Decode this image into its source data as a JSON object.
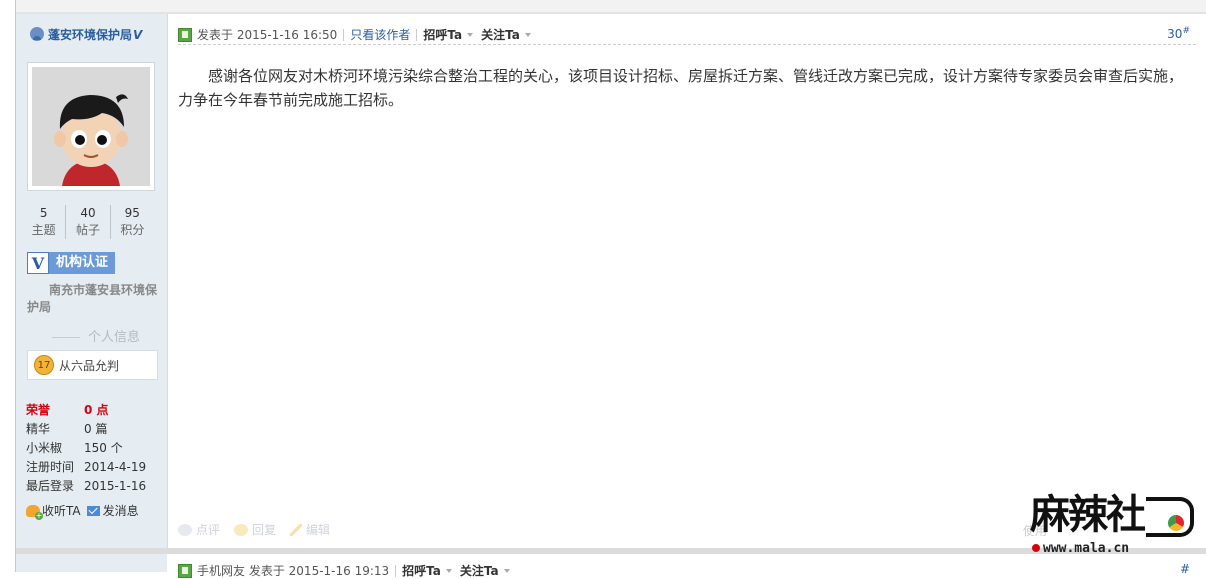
{
  "user": {
    "name": "蓬安环境保护局",
    "verified_mark": "V",
    "stats": [
      {
        "value": "5",
        "label": "主题"
      },
      {
        "value": "40",
        "label": "帖子"
      },
      {
        "value": "95",
        "label": "积分"
      }
    ],
    "verify_badge": {
      "icon": "V",
      "label": "机构认证"
    },
    "organization": "南充市蓬安县环境保护局",
    "personal_info_title": "个人信息",
    "rank": {
      "level": "17",
      "title": "从六品允判"
    },
    "attributes": [
      {
        "key": "荣誉",
        "value": "0 点",
        "highlight": true
      },
      {
        "key": "精华",
        "value": "0 篇",
        "highlight": false
      },
      {
        "key": "小米椒",
        "value": "150 个",
        "highlight": false
      },
      {
        "key": "注册时间",
        "value": "2014-4-19",
        "highlight": false
      },
      {
        "key": "最后登录",
        "value": "2015-1-16",
        "highlight": false
      }
    ],
    "actions": {
      "follow": "收听TA",
      "message": "发消息"
    }
  },
  "post": {
    "posted_at": "发表于 2015-1-16 16:50",
    "only_author": "只看该作者",
    "greet": "招呼Ta",
    "follow": "关注Ta",
    "floor": "30",
    "floor_mark": "#",
    "content": "感谢各位网友对木桥河环境污染综合整治工程的关心，该项目设计招标、房屋拆迁方案、管线迁改方案已完成，设计方案待专家委员会审查后实施，力争在今年春节前完成施工招标。",
    "footer": {
      "comment": "点评",
      "reply": "回复",
      "edit": "编辑",
      "use": "使用"
    }
  },
  "next_post": {
    "author": "手机网友",
    "posted_at": "发表于 2015-1-16 19:13",
    "greet": "招呼Ta",
    "follow": "关注Ta",
    "floor_mark": "#"
  },
  "watermark": {
    "brand": "麻辣社",
    "url": "www.mala.cn"
  },
  "colors": {
    "accent": "#2b5d9e",
    "highlight": "#d8000c",
    "sidebar_bg": "#e5edf2"
  }
}
